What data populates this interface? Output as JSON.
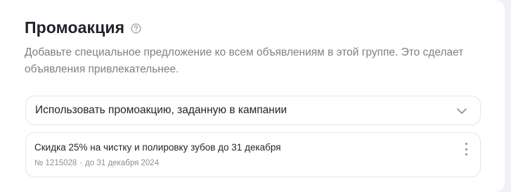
{
  "section": {
    "title": "Промоакция",
    "help_icon": "question-circle-icon",
    "description": "Добавьте специальное предложение ко всем объявлениям в этой группе. Это сделает объявления привлекательнее."
  },
  "promo_select": {
    "value": "Использовать промоакцию, заданную в кампании",
    "icon": "chevron-down-icon"
  },
  "promo_item": {
    "title": "Скидка 25% на чистку и полировку зубов до 31 декабря",
    "number": "№ 1215028",
    "separator": "·",
    "valid_until": "до 31 декабря 2024",
    "menu_icon": "more-vertical-icon"
  },
  "colors": {
    "text_primary": "#1f2329",
    "text_secondary": "#7c8088",
    "border": "#e3e5ea",
    "page_background": "#f1f2f6"
  }
}
